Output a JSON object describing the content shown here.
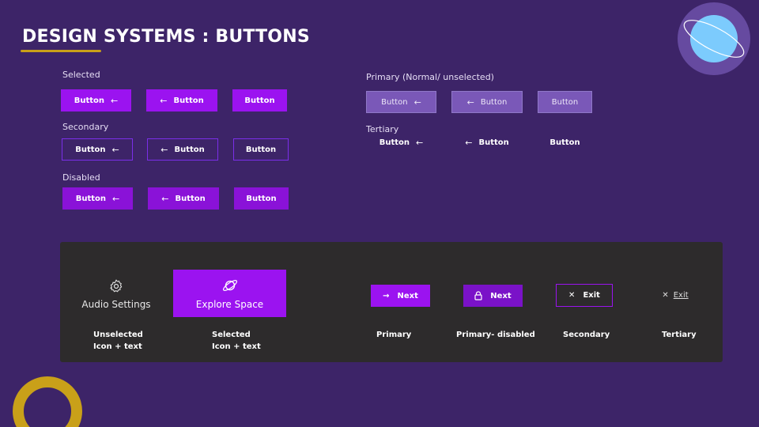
{
  "page": {
    "title": "DESIGN SYSTEMS : BUTTONS"
  },
  "colors": {
    "background": "#3d2468",
    "accent_purple": "#9b13f0",
    "gold": "#c9a019",
    "planet_blue": "#7ccbfd",
    "panel": "#2d2b2c"
  },
  "groups": {
    "selected": {
      "label": "Selected",
      "buttons": [
        {
          "label": "Button",
          "icon": "arrow-left-icon"
        },
        {
          "label": "Button",
          "icon": "arrow-left-icon"
        },
        {
          "label": "Button"
        }
      ]
    },
    "secondary": {
      "label": "Secondary",
      "buttons": [
        {
          "label": "Button",
          "icon": "arrow-left-icon"
        },
        {
          "label": "Button",
          "icon": "arrow-left-icon"
        },
        {
          "label": "Button"
        }
      ]
    },
    "disabled": {
      "label": "Disabled",
      "buttons": [
        {
          "label": "Button",
          "icon": "arrow-left-icon"
        },
        {
          "label": "Button",
          "icon": "arrow-left-icon"
        },
        {
          "label": "Button"
        }
      ]
    },
    "primary": {
      "label": "Primary (Normal/ unselected)",
      "buttons": [
        {
          "label": "Button",
          "icon": "arrow-left-icon"
        },
        {
          "label": "Button",
          "icon": "arrow-left-icon"
        },
        {
          "label": "Button"
        }
      ]
    },
    "tertiary": {
      "label": "Tertiary",
      "buttons": [
        {
          "label": "Button",
          "icon": "arrow-left-icon"
        },
        {
          "label": "Button",
          "icon": "arrow-left-icon"
        },
        {
          "label": "Button"
        }
      ]
    }
  },
  "panel": {
    "audio_settings": {
      "label": "Audio Settings",
      "icon": "gear-icon"
    },
    "explore_space": {
      "label": "Explore Space",
      "icon": "planet-icon"
    },
    "next_primary": {
      "label": "Next",
      "icon": "arrow-right-icon"
    },
    "next_disabled": {
      "label": "Next",
      "icon": "lock-icon"
    },
    "exit_secondary": {
      "label": "Exit",
      "icon": "close-icon"
    },
    "exit_tertiary": {
      "label": "Exit",
      "icon": "close-icon"
    },
    "captions": {
      "unselected_1": "Unselected",
      "unselected_2": "Icon + text",
      "selected_1": "Selected",
      "selected_2": "Icon + text",
      "primary": "Primary",
      "primary_disabled": "Primary- disabled",
      "secondary": "Secondary",
      "tertiary": "Tertiary"
    }
  }
}
